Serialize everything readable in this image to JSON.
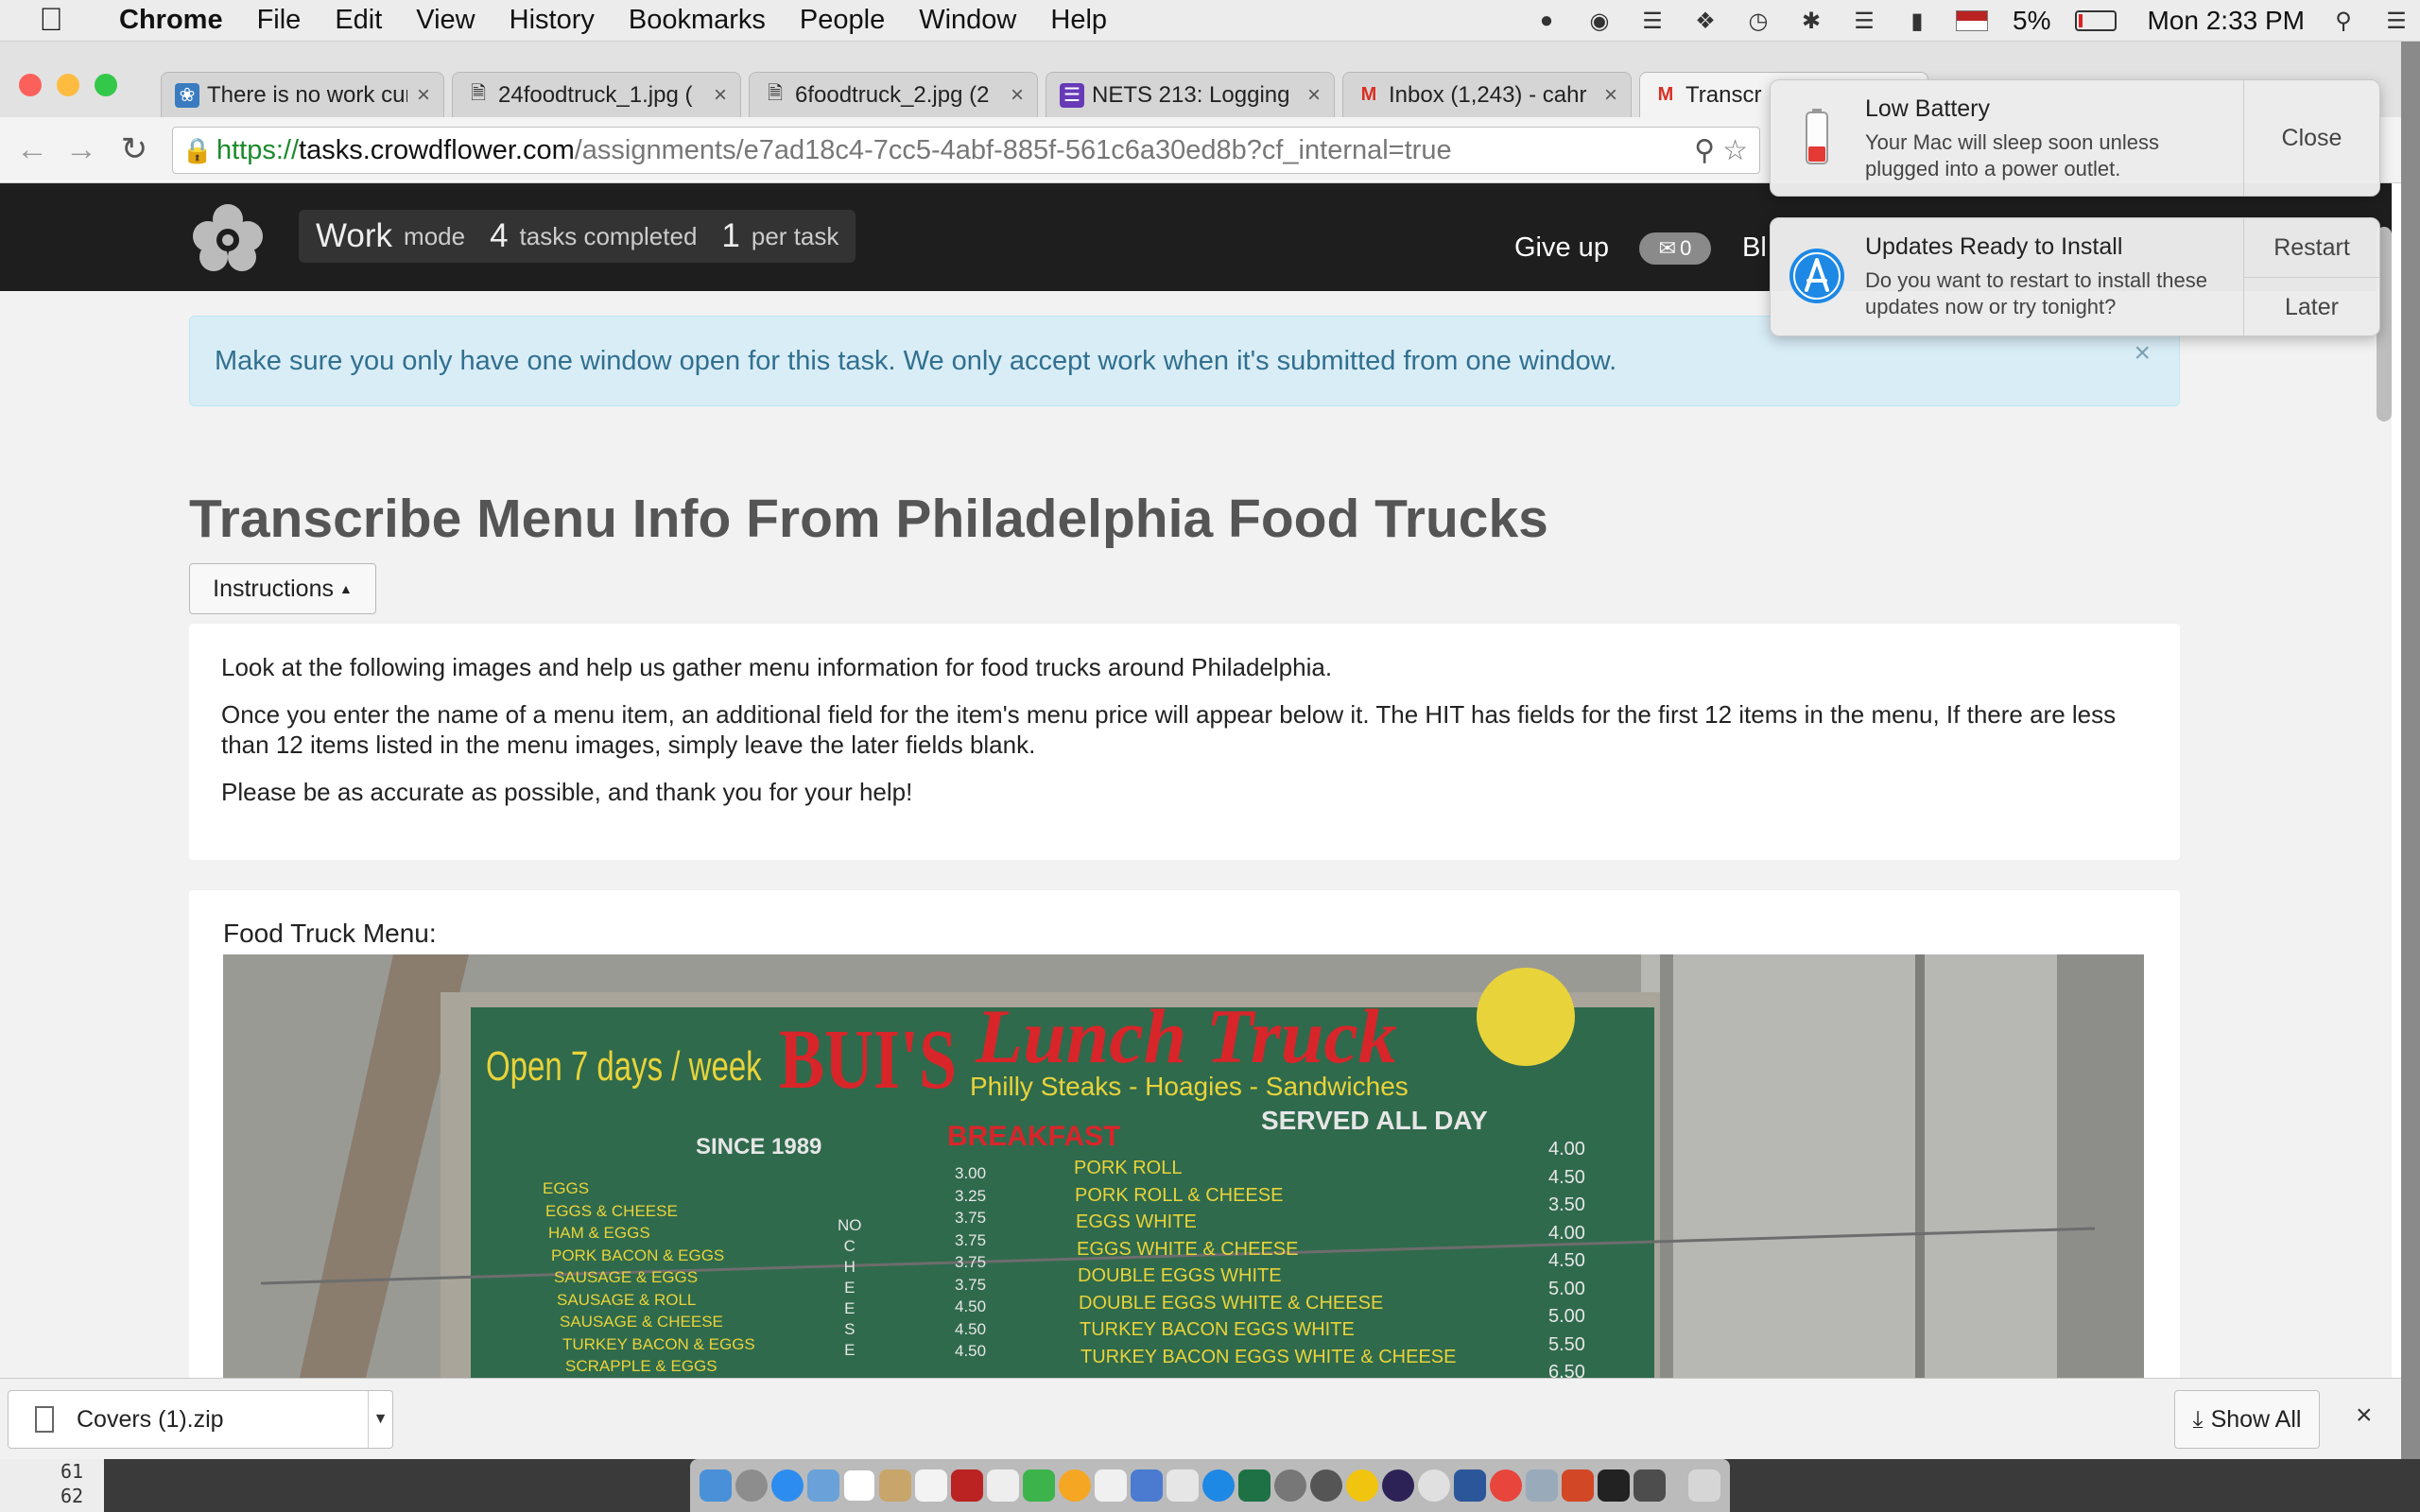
{
  "menubar": {
    "app": "Chrome",
    "items": [
      "File",
      "Edit",
      "View",
      "History",
      "Bookmarks",
      "People",
      "Window",
      "Help"
    ],
    "battery": "5%",
    "clock": "Mon 2:33 PM"
  },
  "tabs": [
    {
      "title": "There is no work cur",
      "favicon": "crowdflower-icon",
      "active": false
    },
    {
      "title": "24foodtruck_1.jpg (",
      "favicon": "file-icon",
      "active": false
    },
    {
      "title": "6foodtruck_2.jpg (2",
      "favicon": "file-icon",
      "active": false
    },
    {
      "title": "NETS 213: Logging",
      "favicon": "list-icon",
      "active": false
    },
    {
      "title": "Inbox (1,243) - cahr",
      "favicon": "gmail-icon",
      "active": false
    },
    {
      "title": "Transcr",
      "favicon": "gmail-icon",
      "active": true
    }
  ],
  "address": {
    "scheme": "https://",
    "host": "tasks.crowdflower.com",
    "path": "/assignments/e7ad18c4-7cc5-4abf-885f-561c6a30ed8b?cf_internal=true"
  },
  "topnav": {
    "work": "Work",
    "mode": "mode",
    "tasks_count": "4",
    "tasks_label": "tasks completed",
    "per_count": "1",
    "per_label": "per task",
    "give_up": "Give up",
    "messages": "0",
    "trunc": "Bl"
  },
  "alert": {
    "text": "Make sure you only have one window open for this task. We only accept work when it's submitted from one window.",
    "close": "×"
  },
  "page": {
    "title": "Transcribe Menu Info From Philadelphia Food Trucks",
    "instructions_button": "Instructions",
    "instructions": [
      "Look at the following images and help us gather menu information for food trucks around Philadelphia.",
      "Once you enter the name of a menu item, an additional field for the item's menu price will appear below it. The HIT has fields for the first 12 items in the menu, If there are less than 12 items listed in the menu images, simply leave the later fields blank.",
      "Please be as accurate as possible, and thank you for your help!"
    ],
    "menu_label": "Food Truck Menu:"
  },
  "menu_sign": {
    "open": "Open 7 days / week",
    "brand": "BUI'S",
    "script": "Lunch Truck",
    "tagline": "Philly Steaks - Hoagies - Sandwiches",
    "since": "SINCE 1989",
    "breakfast": "BREAKFAST",
    "served": "SERVED ALL DAY",
    "left_items": [
      "EGGS",
      "EGGS & CHEESE",
      "HAM & EGGS",
      "PORK BACON & EGGS",
      "SAUSAGE & EGGS",
      "SAUSAGE & ROLL",
      "SAUSAGE & CHEESE",
      "TURKEY BACON & EGGS",
      "SCRAPPLE & EGGS"
    ],
    "notice": [
      "NO",
      "C",
      "H",
      "E",
      "E",
      "S",
      "E"
    ],
    "left_prices": [
      "3.00",
      "3.25",
      "3.75",
      "3.75",
      "3.75",
      "3.75",
      "4.50",
      "4.50",
      "4.50"
    ],
    "right_items": [
      "PORK ROLL",
      "PORK ROLL & CHEESE",
      "EGGS WHITE",
      "EGGS WHITE & CHEESE",
      "DOUBLE EGGS WHITE",
      "DOUBLE EGGS WHITE & CHEESE",
      "TURKEY BACON EGGS WHITE",
      "TURKEY BACON EGGS WHITE  & CHEESE"
    ],
    "right_prices": [
      "4.00",
      "4.50",
      "3.50",
      "4.00",
      "4.50",
      "5.00",
      "5.00",
      "5.50",
      "6.50"
    ]
  },
  "downloads": {
    "file": "Covers (1).zip",
    "show_all": "Show All"
  },
  "notifications": [
    {
      "title": "Low Battery",
      "body": "Your Mac will sleep soon unless plugged into a power outlet.",
      "buttons": [
        "Close"
      ]
    },
    {
      "title": "Updates Ready to Install",
      "body": "Do you want to restart to install these updates now or try tonight?",
      "buttons": [
        "Restart",
        "Later"
      ]
    }
  ],
  "terminal_lines": [
    "61",
    "62"
  ],
  "colors": {
    "accent": "#31708f",
    "navbar": "#1e1e1e",
    "sign_green": "#2f6a4c",
    "sign_red": "#d8252a",
    "sign_yellow": "#e9d33a"
  }
}
